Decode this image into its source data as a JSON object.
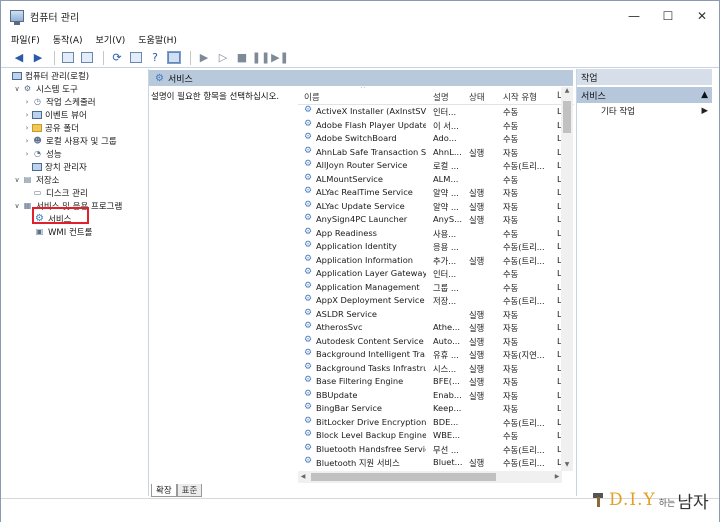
{
  "window": {
    "title": "컴퓨터 관리",
    "controls": {
      "minimize": "—",
      "maximize": "☐",
      "close": "✕"
    }
  },
  "menubar": [
    "파일(F)",
    "동작(A)",
    "보기(V)",
    "도움말(H)"
  ],
  "tree": {
    "root": "컴퓨터 관리(로컬)",
    "system_tools": "시스템 도구",
    "task_scheduler": "작업 스케줄러",
    "event_viewer": "이벤트 뷰어",
    "shared_folders": "공유 폴더",
    "local_users": "로컬 사용자 및 그룹",
    "performance": "성능",
    "device_manager": "장치 관리자",
    "storage": "저장소",
    "disk_management": "디스크 관리",
    "services_apps": "서비스 및 응용 프로그램",
    "services": "서비스",
    "wmi": "WMI 컨트롤"
  },
  "center": {
    "header": "서비스",
    "description": "설명이 필요한 항목을 선택하십시오.",
    "columns": {
      "name": "이름",
      "desc": "설명",
      "status": "상태",
      "startup": "시작 유형",
      "logon": "L"
    }
  },
  "services": [
    {
      "name": "ActiveX Installer (AxInstSV)",
      "desc": "인터...",
      "status": "",
      "startup": "수동",
      "logon": "L"
    },
    {
      "name": "Adobe Flash Player Update...",
      "desc": "이 서...",
      "status": "",
      "startup": "수동",
      "logon": "L"
    },
    {
      "name": "Adobe SwitchBoard",
      "desc": "Ado...",
      "status": "",
      "startup": "수동",
      "logon": "L"
    },
    {
      "name": "AhnLab Safe Transaction S...",
      "desc": "AhnL...",
      "status": "실행",
      "startup": "자동",
      "logon": "L"
    },
    {
      "name": "AllJoyn Router Service",
      "desc": "로컬 ...",
      "status": "",
      "startup": "수동(트리...",
      "logon": "L"
    },
    {
      "name": "ALMountService",
      "desc": "ALM...",
      "status": "",
      "startup": "수동",
      "logon": "L"
    },
    {
      "name": "ALYac RealTime Service",
      "desc": "알약 ...",
      "status": "실행",
      "startup": "자동",
      "logon": "L"
    },
    {
      "name": "ALYac Update Service",
      "desc": "알약 ...",
      "status": "실행",
      "startup": "자동",
      "logon": "L"
    },
    {
      "name": "AnySign4PC Launcher",
      "desc": "AnyS...",
      "status": "실행",
      "startup": "자동",
      "logon": "L"
    },
    {
      "name": "App Readiness",
      "desc": "사용...",
      "status": "",
      "startup": "수동",
      "logon": "L"
    },
    {
      "name": "Application Identity",
      "desc": "응용 ...",
      "status": "",
      "startup": "수동(트리...",
      "logon": "L"
    },
    {
      "name": "Application Information",
      "desc": "추가...",
      "status": "실행",
      "startup": "수동(트리...",
      "logon": "L"
    },
    {
      "name": "Application Layer Gateway ...",
      "desc": "인터...",
      "status": "",
      "startup": "수동",
      "logon": "L"
    },
    {
      "name": "Application Management",
      "desc": "그룹 ...",
      "status": "",
      "startup": "수동",
      "logon": "L"
    },
    {
      "name": "AppX Deployment Service ...",
      "desc": "저장...",
      "status": "",
      "startup": "수동(트리...",
      "logon": "L"
    },
    {
      "name": "ASLDR Service",
      "desc": "",
      "status": "실행",
      "startup": "자동",
      "logon": "L"
    },
    {
      "name": "AtherosSvc",
      "desc": "Athe...",
      "status": "실행",
      "startup": "자동",
      "logon": "L"
    },
    {
      "name": "Autodesk Content Service",
      "desc": "Auto...",
      "status": "실행",
      "startup": "자동",
      "logon": "L"
    },
    {
      "name": "Background Intelligent Tra...",
      "desc": "유휴 ...",
      "status": "실행",
      "startup": "자동(지연...",
      "logon": "L"
    },
    {
      "name": "Background Tasks Infrastru...",
      "desc": "시스...",
      "status": "실행",
      "startup": "자동",
      "logon": "L"
    },
    {
      "name": "Base Filtering Engine",
      "desc": "BFE(...",
      "status": "실행",
      "startup": "자동",
      "logon": "L"
    },
    {
      "name": "BBUpdate",
      "desc": "Enab...",
      "status": "실행",
      "startup": "자동",
      "logon": "L"
    },
    {
      "name": "BingBar Service",
      "desc": "Keep...",
      "status": "",
      "startup": "자동",
      "logon": "L"
    },
    {
      "name": "BitLocker Drive Encryption ...",
      "desc": "BDE...",
      "status": "",
      "startup": "수동(트리...",
      "logon": "L"
    },
    {
      "name": "Block Level Backup Engine ...",
      "desc": "WBE...",
      "status": "",
      "startup": "수동",
      "logon": "L"
    },
    {
      "name": "Bluetooth Handsfree Service",
      "desc": "무선 ...",
      "status": "",
      "startup": "수동(트리...",
      "logon": "L"
    },
    {
      "name": "Bluetooth 지원 서비스",
      "desc": "Bluet...",
      "status": "실행",
      "startup": "수동(트리...",
      "logon": "L"
    }
  ],
  "tabs": {
    "extended": "확장",
    "standard": "표준"
  },
  "actions": {
    "header": "작업",
    "section": "서비스",
    "more": "기타 작업"
  },
  "brand": {
    "diy": "D.I.Y",
    "ha": "하는",
    "man": "남자"
  },
  "colors": {
    "selection_outline": "#e0202a",
    "pane_header": "#b9c9dc",
    "brand_orange": "#e3a020"
  }
}
